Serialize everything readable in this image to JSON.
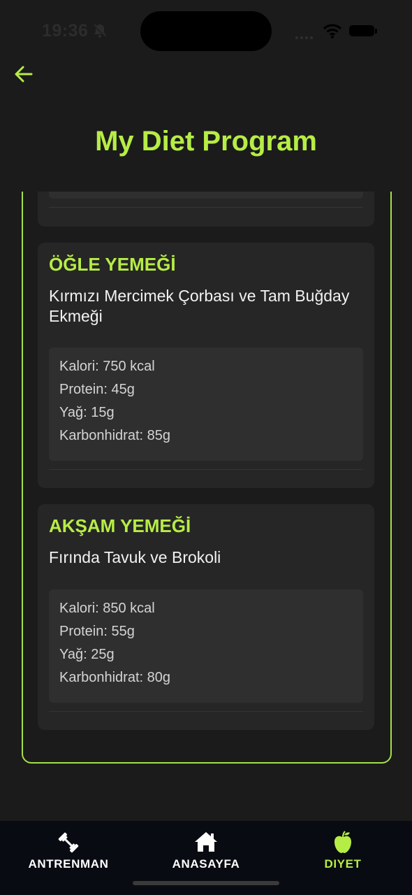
{
  "status": {
    "time": "19:36"
  },
  "header": {
    "title": "My Diet Program"
  },
  "meals": [
    {
      "label": "ÖĞLE YEMEĞİ",
      "name": "Kırmızı Mercimek Çorbası ve Tam Buğday Ekmeği",
      "calories": "Kalori: 750 kcal",
      "protein": "Protein: 45g",
      "fat": "Yağ: 15g",
      "carbs": "Karbonhidrat: 85g"
    },
    {
      "label": "AKŞAM YEMEĞİ",
      "name": "Fırında Tavuk ve Brokoli",
      "calories": "Kalori: 850 kcal",
      "protein": "Protein: 55g",
      "fat": "Yağ: 25g",
      "carbs": "Karbonhidrat: 80g"
    }
  ],
  "tabbar": {
    "items": [
      {
        "label": "ANTRENMAN",
        "icon": "dumbbell-icon"
      },
      {
        "label": "ANASAYFA",
        "icon": "home-icon"
      },
      {
        "label": "DIYET",
        "icon": "apple-icon"
      }
    ],
    "active": "DIYET"
  },
  "colors": {
    "accent": "#b6ed45",
    "background": "#1b1b1b",
    "card": "#262626",
    "tabbar": "#090b12"
  }
}
